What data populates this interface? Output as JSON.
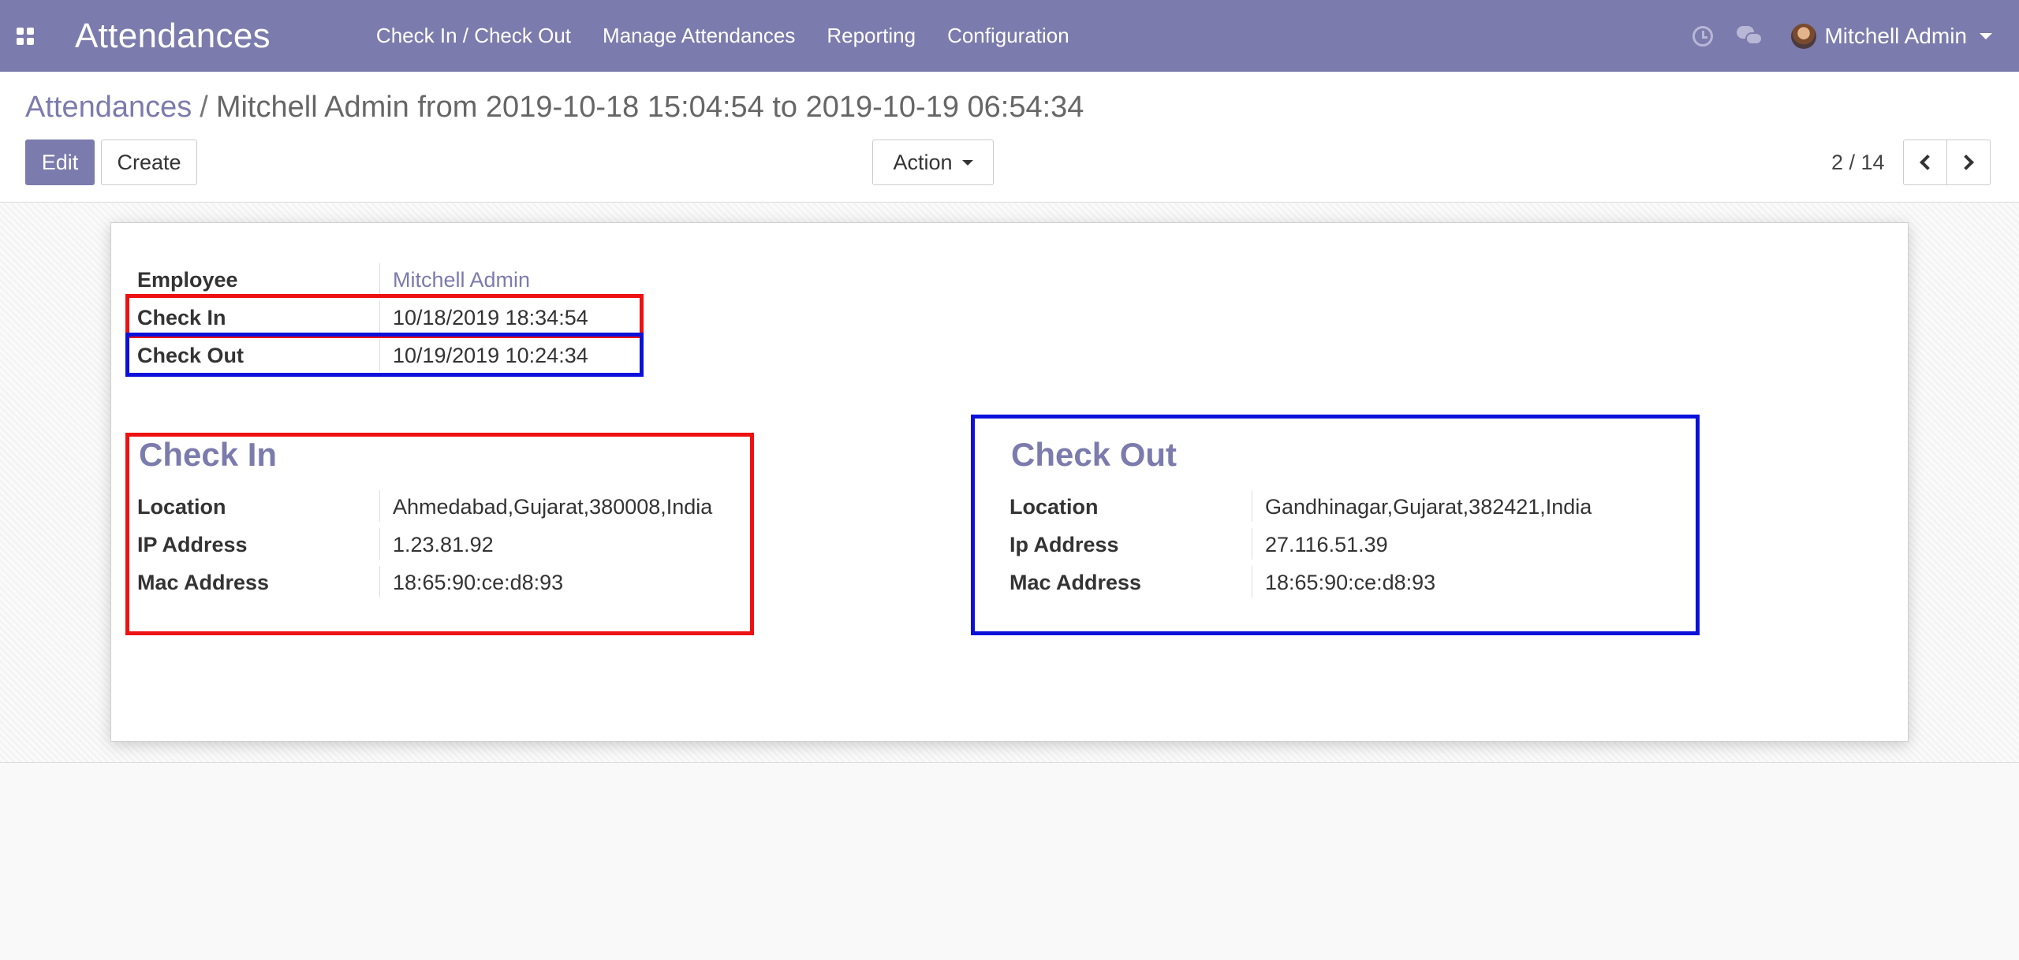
{
  "navbar": {
    "app_title": "Attendances",
    "menu": [
      "Check In / Check Out",
      "Manage Attendances",
      "Reporting",
      "Configuration"
    ],
    "user_name": "Mitchell Admin",
    "icons": [
      "apps-grid-icon",
      "clock-icon",
      "chat-icon",
      "user-avatar",
      "caret-down-icon"
    ],
    "color": "#7c7bad"
  },
  "breadcrumb": {
    "parent": "Attendances",
    "separator": "/",
    "current": "Mitchell Admin from 2019-10-18 15:04:54 to 2019-10-19 06:54:34"
  },
  "buttons": {
    "edit": "Edit",
    "create": "Create",
    "action": "Action"
  },
  "pager": {
    "value": "2 / 14"
  },
  "form": {
    "employee": {
      "label": "Employee",
      "value": "Mitchell Admin"
    },
    "check_in": {
      "label": "Check In",
      "value": "10/18/2019 18:34:54"
    },
    "check_out": {
      "label": "Check Out",
      "value": "10/19/2019 10:24:34"
    }
  },
  "check_in_group": {
    "title": "Check In",
    "fields": [
      {
        "label": "Location",
        "value": "Ahmedabad,Gujarat,380008,India"
      },
      {
        "label": "IP Address",
        "value": "1.23.81.92"
      },
      {
        "label": "Mac Address",
        "value": "18:65:90:ce:d8:93"
      }
    ]
  },
  "check_out_group": {
    "title": "Check Out",
    "fields": [
      {
        "label": "Location",
        "value": "Gandhinagar,Gujarat,382421,India"
      },
      {
        "label": "Ip Address",
        "value": "27.116.51.39"
      },
      {
        "label": "Mac Address",
        "value": "18:65:90:ce:d8:93"
      }
    ]
  },
  "highlight_colors": {
    "red": "#ee1111",
    "blue": "#0b11d9"
  }
}
